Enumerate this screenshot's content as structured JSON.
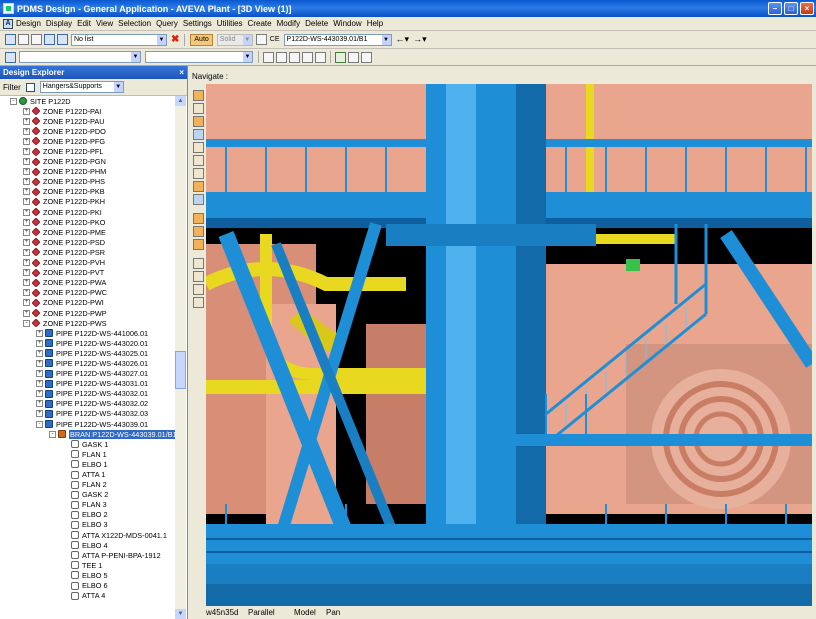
{
  "window": {
    "title": "PDMS Design - General Application - AVEVA Plant - [3D View (1)]"
  },
  "menu": [
    "Design",
    "Display",
    "Edit",
    "View",
    "Selection",
    "Query",
    "Settings",
    "Utilities",
    "Create",
    "Modify",
    "Delete",
    "Window",
    "Help"
  ],
  "toolbar": {
    "list_combo": "No list",
    "auto_button": "Auto",
    "solid_combo": "Solid",
    "ce_label": "CE",
    "ce_value": "P122D-WS-443039.01/B1"
  },
  "explorer": {
    "title": "Design Explorer",
    "pin_glyph": " ×",
    "filter_label": "Filter",
    "filter_value": "Hangers&Supports",
    "tree": [
      {
        "label": "SITE P122D",
        "level": 0,
        "icon": "site",
        "exp": "-"
      },
      {
        "label": "ZONE P122D-PAI",
        "level": 1,
        "icon": "zone",
        "exp": "+"
      },
      {
        "label": "ZONE P122D-PAU",
        "level": 1,
        "icon": "zone",
        "exp": "+"
      },
      {
        "label": "ZONE P122D-PDO",
        "level": 1,
        "icon": "zone",
        "exp": "+"
      },
      {
        "label": "ZONE P122D-PFG",
        "level": 1,
        "icon": "zone",
        "exp": "+"
      },
      {
        "label": "ZONE P122D-PFL",
        "level": 1,
        "icon": "zone",
        "exp": "+"
      },
      {
        "label": "ZONE P122D-PGN",
        "level": 1,
        "icon": "zone",
        "exp": "+"
      },
      {
        "label": "ZONE P122D-PHM",
        "level": 1,
        "icon": "zone",
        "exp": "+"
      },
      {
        "label": "ZONE P122D-PHS",
        "level": 1,
        "icon": "zone",
        "exp": "+"
      },
      {
        "label": "ZONE P122D-PKB",
        "level": 1,
        "icon": "zone",
        "exp": "+"
      },
      {
        "label": "ZONE P122D-PKH",
        "level": 1,
        "icon": "zone",
        "exp": "+"
      },
      {
        "label": "ZONE P122D-PKI",
        "level": 1,
        "icon": "zone",
        "exp": "+"
      },
      {
        "label": "ZONE P122D-PKO",
        "level": 1,
        "icon": "zone",
        "exp": "+"
      },
      {
        "label": "ZONE P122D-PME",
        "level": 1,
        "icon": "zone",
        "exp": "+"
      },
      {
        "label": "ZONE P122D-PSD",
        "level": 1,
        "icon": "zone",
        "exp": "+"
      },
      {
        "label": "ZONE P122D-PSR",
        "level": 1,
        "icon": "zone",
        "exp": "+"
      },
      {
        "label": "ZONE P122D-PVH",
        "level": 1,
        "icon": "zone",
        "exp": "+"
      },
      {
        "label": "ZONE P122D-PVT",
        "level": 1,
        "icon": "zone",
        "exp": "+"
      },
      {
        "label": "ZONE P122D-PWA",
        "level": 1,
        "icon": "zone",
        "exp": "+"
      },
      {
        "label": "ZONE P122D-PWC",
        "level": 1,
        "icon": "zone",
        "exp": "+"
      },
      {
        "label": "ZONE P122D-PWI",
        "level": 1,
        "icon": "zone",
        "exp": "+"
      },
      {
        "label": "ZONE P122D-PWP",
        "level": 1,
        "icon": "zone",
        "exp": "+"
      },
      {
        "label": "ZONE P122D-PWS",
        "level": 1,
        "icon": "zone",
        "exp": "-"
      },
      {
        "label": "PIPE P122D-WS-441006.01",
        "level": 2,
        "icon": "pipe",
        "exp": "+"
      },
      {
        "label": "PIPE P122D-WS-443020.01",
        "level": 2,
        "icon": "pipe",
        "exp": "+"
      },
      {
        "label": "PIPE P122D-WS-443025.01",
        "level": 2,
        "icon": "pipe",
        "exp": "+"
      },
      {
        "label": "PIPE P122D-WS-443026.01",
        "level": 2,
        "icon": "pipe",
        "exp": "+"
      },
      {
        "label": "PIPE P122D-WS-443027.01",
        "level": 2,
        "icon": "pipe",
        "exp": "+"
      },
      {
        "label": "PIPE P122D-WS-443031.01",
        "level": 2,
        "icon": "pipe",
        "exp": "+"
      },
      {
        "label": "PIPE P122D-WS-443032.01",
        "level": 2,
        "icon": "pipe",
        "exp": "+"
      },
      {
        "label": "PIPE P122D-WS-443032.02",
        "level": 2,
        "icon": "pipe",
        "exp": "+"
      },
      {
        "label": "PIPE P122D-WS-443032.03",
        "level": 2,
        "icon": "pipe",
        "exp": "+"
      },
      {
        "label": "PIPE P122D-WS-443039.01",
        "level": 2,
        "icon": "pipe",
        "exp": "-"
      },
      {
        "label": "BRAN P122D-WS-443039.01/B1",
        "level": 3,
        "icon": "bran",
        "exp": "-",
        "selected": true
      },
      {
        "label": "GASK 1",
        "level": 4,
        "icon": "comp",
        "exp": ""
      },
      {
        "label": "FLAN 1",
        "level": 4,
        "icon": "comp",
        "exp": ""
      },
      {
        "label": "ELBO 1",
        "level": 4,
        "icon": "comp",
        "exp": ""
      },
      {
        "label": "ATTA 1",
        "level": 4,
        "icon": "comp",
        "exp": ""
      },
      {
        "label": "FLAN 2",
        "level": 4,
        "icon": "comp",
        "exp": ""
      },
      {
        "label": "GASK 2",
        "level": 4,
        "icon": "comp",
        "exp": ""
      },
      {
        "label": "FLAN 3",
        "level": 4,
        "icon": "comp",
        "exp": ""
      },
      {
        "label": "ELBO 2",
        "level": 4,
        "icon": "comp",
        "exp": ""
      },
      {
        "label": "ELBO 3",
        "level": 4,
        "icon": "comp",
        "exp": ""
      },
      {
        "label": "ATTA X122D-MDS-0041.1",
        "level": 4,
        "icon": "comp",
        "exp": ""
      },
      {
        "label": "ELBO 4",
        "level": 4,
        "icon": "comp",
        "exp": ""
      },
      {
        "label": "ATTA P-PENI-BPA-1912",
        "level": 4,
        "icon": "comp",
        "exp": ""
      },
      {
        "label": "TEE 1",
        "level": 4,
        "icon": "comp",
        "exp": ""
      },
      {
        "label": "ELBO 5",
        "level": 4,
        "icon": "comp",
        "exp": ""
      },
      {
        "label": "ELBO 6",
        "level": 4,
        "icon": "comp",
        "exp": ""
      },
      {
        "label": "ATTA 4",
        "level": 4,
        "icon": "comp",
        "exp": ""
      }
    ]
  },
  "view": {
    "navigate_label": "Navigate :",
    "status": {
      "direction": "w45n35d",
      "projection": "Parallel",
      "mode": "Model",
      "action": "Pan"
    },
    "colors": {
      "steel_blue": "#1e8fd6",
      "pipe_yellow": "#e8d820",
      "equip_salmon": "#e9a58e",
      "background": "#000000"
    }
  }
}
